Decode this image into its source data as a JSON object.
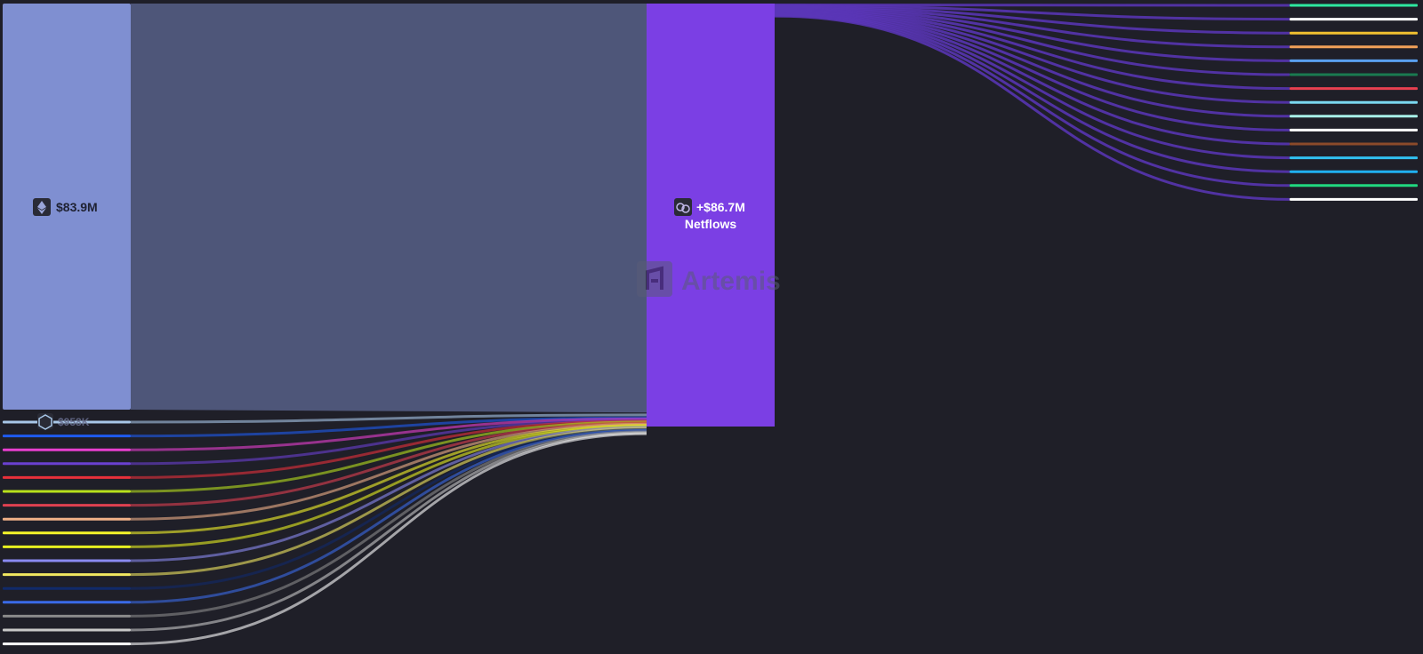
{
  "colors": {
    "background": "#1f1f28",
    "eth_node": "#7f8fd1",
    "main_flow": "#4e5679",
    "netflows_node": "#7b3fe4",
    "out_flow": "#5b36b8",
    "label_dark": "#1f2233",
    "label_light": "#ffffff",
    "icon_bg": "#2a2b36",
    "watermark": "#5a5c78"
  },
  "chart_data": {
    "type": "sankey",
    "title": "",
    "sources": [
      {
        "id": "ethereum",
        "label": "$83.9M",
        "icon": "ethereum-icon",
        "color": "#7f8fd1",
        "share": 0.967
      },
      {
        "id": "arbitrum",
        "label": "$958K",
        "icon": "arbitrum-icon",
        "color": "#a8c7e8",
        "share": 0.011
      },
      {
        "id": "s3",
        "color": "#1e5bf0",
        "share": 0.0015
      },
      {
        "id": "s4",
        "color": "#e83fd0",
        "share": 0.0015
      },
      {
        "id": "s5",
        "color": "#6a40d0",
        "share": 0.0015
      },
      {
        "id": "s6",
        "color": "#e8303a",
        "share": 0.0015
      },
      {
        "id": "s7",
        "color": "#b8e01c",
        "share": 0.0015
      },
      {
        "id": "s8",
        "color": "#e04050",
        "share": 0.0015
      },
      {
        "id": "s9",
        "color": "#f0b088",
        "share": 0.0015
      },
      {
        "id": "s10",
        "color": "#f5f52a",
        "share": 0.0015
      },
      {
        "id": "s11",
        "color": "#e8f020",
        "share": 0.0015
      },
      {
        "id": "s12",
        "color": "#8a8af0",
        "share": 0.0015
      },
      {
        "id": "s13",
        "color": "#f2e860",
        "share": 0.0015
      },
      {
        "id": "s14",
        "color": "#102a6a",
        "share": 0.0015
      },
      {
        "id": "s15",
        "color": "#3a6ae8",
        "share": 0.0015
      },
      {
        "id": "s16",
        "color": "#8a8a8a",
        "share": 0.0015
      },
      {
        "id": "s17",
        "color": "#c8c8c8",
        "share": 0.0015
      },
      {
        "id": "s18",
        "color": "#ffffff",
        "share": 0.0015
      }
    ],
    "center": {
      "id": "netflows",
      "value_label": "+$86.7M",
      "name_label": "Netflows",
      "icon": "chain-link-icon",
      "color": "#7b3fe4"
    },
    "targets": [
      {
        "id": "t1",
        "color": "#2ee8a0"
      },
      {
        "id": "t2",
        "color": "#ffffff"
      },
      {
        "id": "t3",
        "color": "#f0c030"
      },
      {
        "id": "t4",
        "color": "#f0a058"
      },
      {
        "id": "t5",
        "color": "#5aa0f0"
      },
      {
        "id": "t6",
        "color": "#1a7a50"
      },
      {
        "id": "t7",
        "color": "#e84050"
      },
      {
        "id": "t8",
        "color": "#7ad8f0"
      },
      {
        "id": "t9",
        "color": "#a8f0e8"
      },
      {
        "id": "t10",
        "color": "#ffffff"
      },
      {
        "id": "t11",
        "color": "#8a4a2a"
      },
      {
        "id": "t12",
        "color": "#30c0f0"
      },
      {
        "id": "t13",
        "color": "#20b0f0"
      },
      {
        "id": "t14",
        "color": "#20d880"
      },
      {
        "id": "t15",
        "color": "#ffffff"
      }
    ]
  },
  "watermark": {
    "text": "Artemis",
    "icon": "artemis-logo-icon"
  }
}
